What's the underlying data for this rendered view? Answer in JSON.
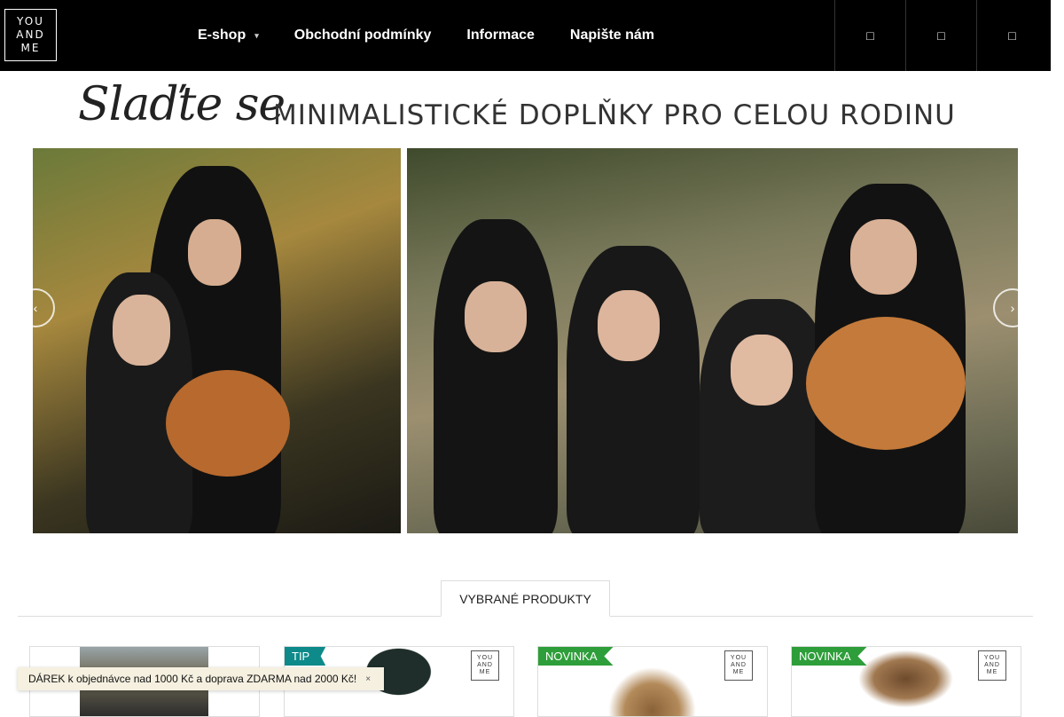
{
  "logo": {
    "lines": [
      "YOU",
      "AND",
      "ME"
    ]
  },
  "nav": {
    "items": [
      {
        "label": "E-shop",
        "has_dropdown": true
      },
      {
        "label": "Obchodní podmínky"
      },
      {
        "label": "Informace"
      },
      {
        "label": "Napište nám"
      }
    ],
    "dropdown_caret": "▾"
  },
  "header_icons": [
    {
      "name": "search-icon",
      "glyph": "□"
    },
    {
      "name": "user-icon",
      "glyph": "□"
    },
    {
      "name": "cart-icon",
      "glyph": "□"
    }
  ],
  "banner": {
    "script_title": "Slaďte se",
    "caps_title": "MINIMALISTICKÉ DOPLŇKY PRO CELOU RODINU",
    "prev_glyph": "‹",
    "next_glyph": "›"
  },
  "tabs": {
    "active": "VYBRANÉ PRODUKTY"
  },
  "products": [
    {
      "badge": "",
      "badge_color": "",
      "has_logo": false
    },
    {
      "badge": "TIP",
      "badge_color": "#0e8a8a",
      "has_logo": true
    },
    {
      "badge": "NOVINKA",
      "badge_color": "#2e9e3a",
      "has_logo": true
    },
    {
      "badge": "NOVINKA",
      "badge_color": "#2e9e3a",
      "has_logo": true
    }
  ],
  "promo": {
    "text": "DÁREK k objednávce nad 1000 Kč a doprava ZDARMA nad 2000 Kč!",
    "close_glyph": "×"
  }
}
